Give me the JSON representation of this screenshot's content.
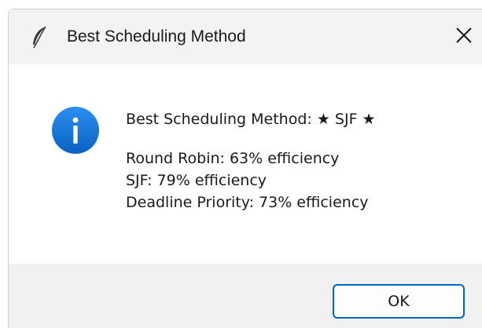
{
  "window": {
    "title": "Best Scheduling Method",
    "app_icon": "feather-icon",
    "close_icon": "close-icon"
  },
  "message": {
    "icon": "info-icon",
    "headline": "Best Scheduling Method: ★ SJF ★",
    "lines": [
      "Round Robin: 63% efficiency",
      "SJF: 79% efficiency",
      "Deadline Priority: 73% efficiency"
    ]
  },
  "buttons": {
    "ok_label": "OK"
  },
  "colors": {
    "accent": "#0067c0",
    "info_icon": "#1b7fe0",
    "titlebar": "#f3f3f3",
    "footer": "#f0f0f0"
  }
}
